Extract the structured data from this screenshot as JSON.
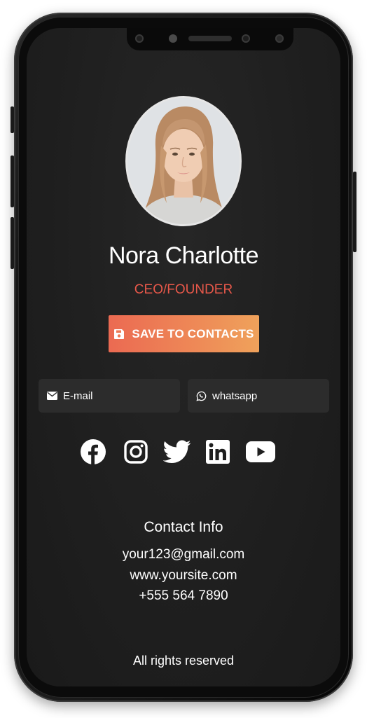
{
  "profile": {
    "name": "Nora Charlotte",
    "role": "CEO/FOUNDER"
  },
  "actions": {
    "save_label": "SAVE TO CONTACTS",
    "email_label": "E-mail",
    "whatsapp_label": "whatsapp"
  },
  "socials": [
    {
      "name": "facebook",
      "icon": "facebook-icon"
    },
    {
      "name": "instagram",
      "icon": "instagram-icon"
    },
    {
      "name": "twitter",
      "icon": "twitter-icon"
    },
    {
      "name": "linkedin",
      "icon": "linkedin-icon"
    },
    {
      "name": "youtube",
      "icon": "youtube-icon"
    }
  ],
  "contact": {
    "title": "Contact Info",
    "email": "your123@gmail.com",
    "website": "www.yoursite.com",
    "phone": "+555 564 7890"
  },
  "footer": {
    "text": "All rights reserved"
  },
  "colors": {
    "accent": "#e8584a",
    "button_gradient_start": "#eb6a52",
    "button_gradient_end": "#efa25b",
    "background": "#1f1f1f",
    "secondary_button": "#2c2c2c"
  }
}
